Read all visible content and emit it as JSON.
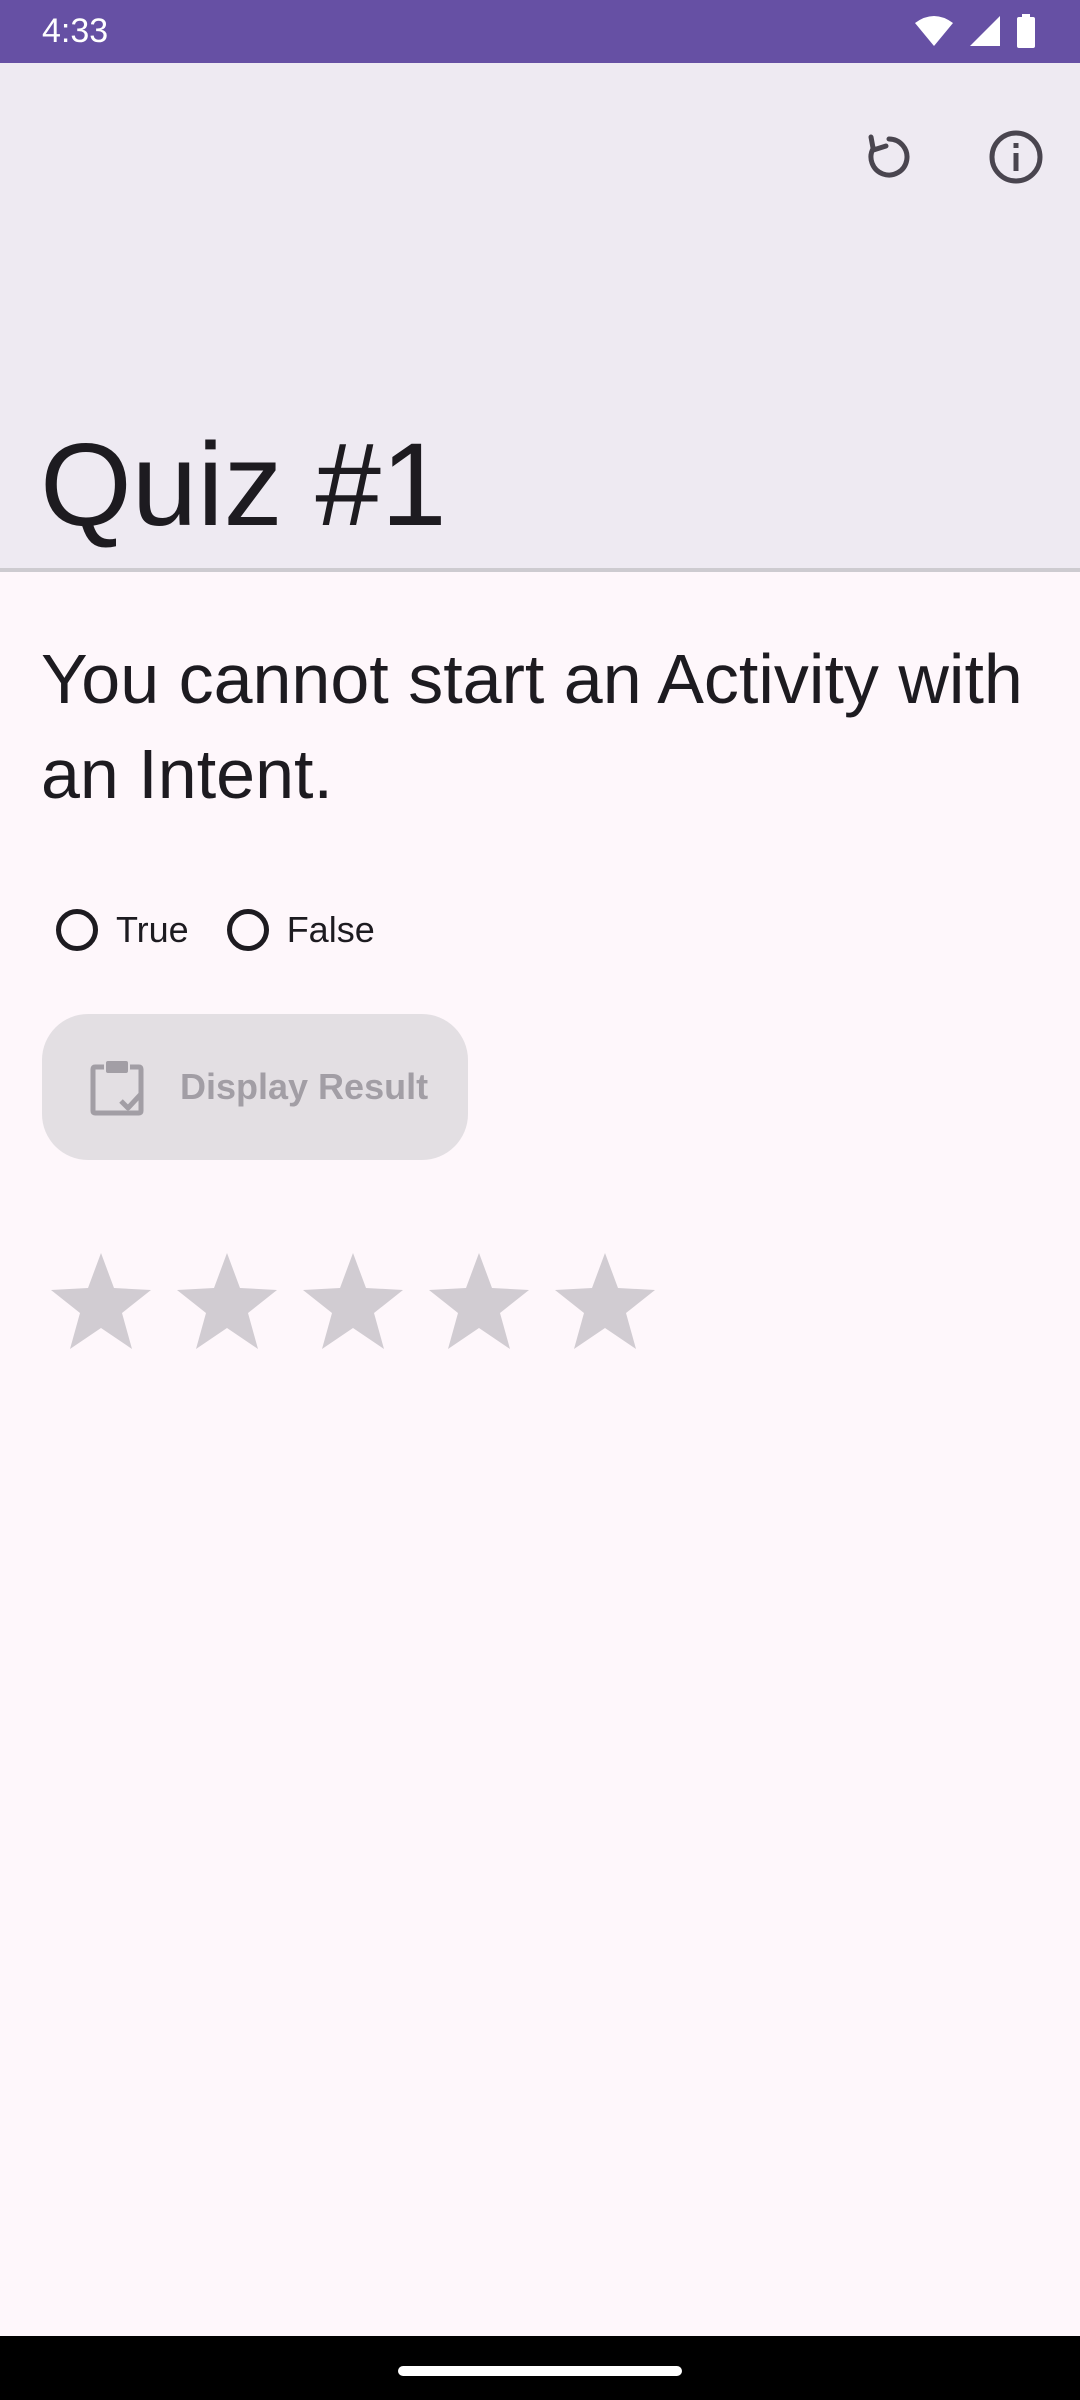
{
  "status_bar": {
    "time": "4:33",
    "background": "#6650A4",
    "icons": [
      "wifi-icon",
      "signal-icon",
      "battery-icon"
    ]
  },
  "app_bar": {
    "title": "Quiz #1",
    "background": "#EEEAF2",
    "actions": [
      "reload-icon",
      "info-icon"
    ]
  },
  "question": {
    "text": "You cannot start an Activity with an Intent."
  },
  "answers": {
    "options": [
      {
        "label": "True",
        "selected": false
      },
      {
        "label": "False",
        "selected": false
      }
    ]
  },
  "result_button": {
    "label": "Display Result",
    "icon": "clipboard-check-icon",
    "enabled": false
  },
  "rating": {
    "max": 5,
    "value": 0
  },
  "colors": {
    "accent": "#6650A4",
    "disabled_text": "#A29EA5",
    "star_inactive": "#D1CCD2"
  }
}
